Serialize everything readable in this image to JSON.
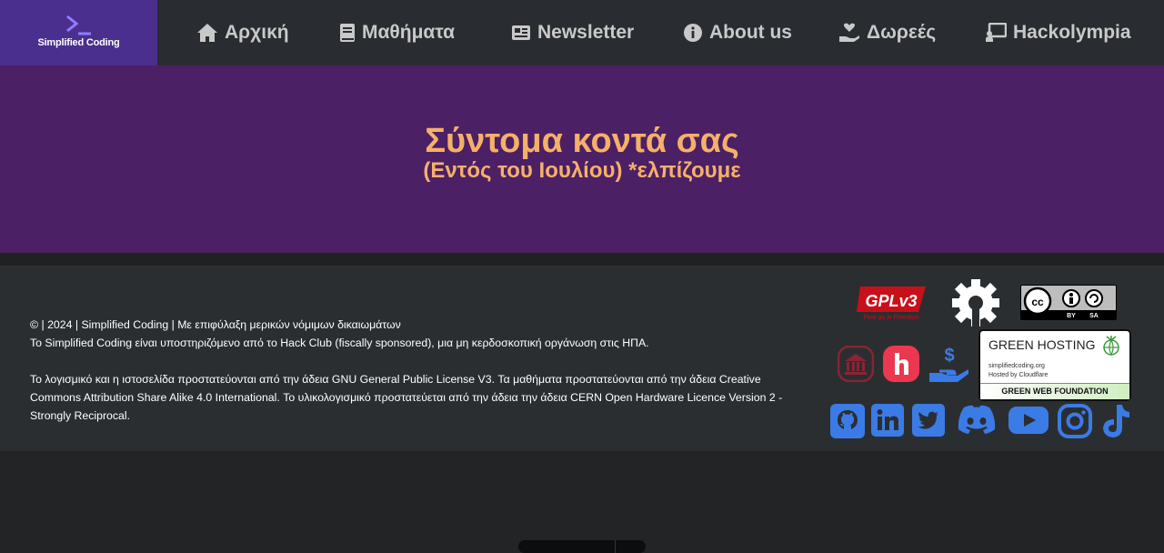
{
  "brand": {
    "name": "Simplified Coding"
  },
  "nav": [
    {
      "label": "Αρχική",
      "icon": "home-icon"
    },
    {
      "label": "Μαθήματα",
      "icon": "book-icon"
    },
    {
      "label": "Newsletter",
      "icon": "newspaper-icon"
    },
    {
      "label": "About us",
      "icon": "info-icon"
    },
    {
      "label": "Δωρεές",
      "icon": "donate-heart-icon"
    },
    {
      "label": "Hackolympia",
      "icon": "chalkboard-icon"
    }
  ],
  "hero": {
    "title": "Σύντομα κοντά σας",
    "subtitle": "(Εντός του Ιουλίου) *ελπίζουμε"
  },
  "footer": {
    "line1": "© | 2024 | Simplified Coding | Με επιφύλαξη μερικών νόμιμων δικαιωμάτων",
    "line2": "Το Simplified Coding είναι υποστηριζόμενο από το Hack Club (fiscally sponsored), μια μη κερδοσκοπική οργάνωση στις ΗΠΑ.",
    "line3": "Το λογισμικό και η ιστοσελίδα προστατεύονται από την άδεια GNU General Public License V3. Τα μαθήματα προστατεύονται από την άδεια Creative Commons Attribution Share Alike 4.0 International. Το υλικολογισμικό προστατεύεται από την άδεια την άδεια CERN Open Hardware Licence Version 2 - Strongly Reciprocal."
  },
  "badges": {
    "gpl_text": "GPLv3",
    "gpl_tagline": "Free as in Freedom",
    "cc_by": "BY",
    "cc_sa": "SA",
    "green_title": "GREEN HOSTING",
    "green_domain": "simplifiedcoding.org",
    "green_host": "Hosted by Cloudflare",
    "green_foundation": "GREEN WEB FOUNDATION"
  },
  "social": [
    "github-icon",
    "linkedin-icon",
    "twitter-icon",
    "discord-icon",
    "youtube-icon",
    "instagram-icon",
    "tiktok-icon"
  ],
  "colors": {
    "accent": "#3b7be6",
    "hero_bg": "#4c2064",
    "hero_text": "#f5b06a",
    "logo_bg": "#4a2f8f"
  }
}
